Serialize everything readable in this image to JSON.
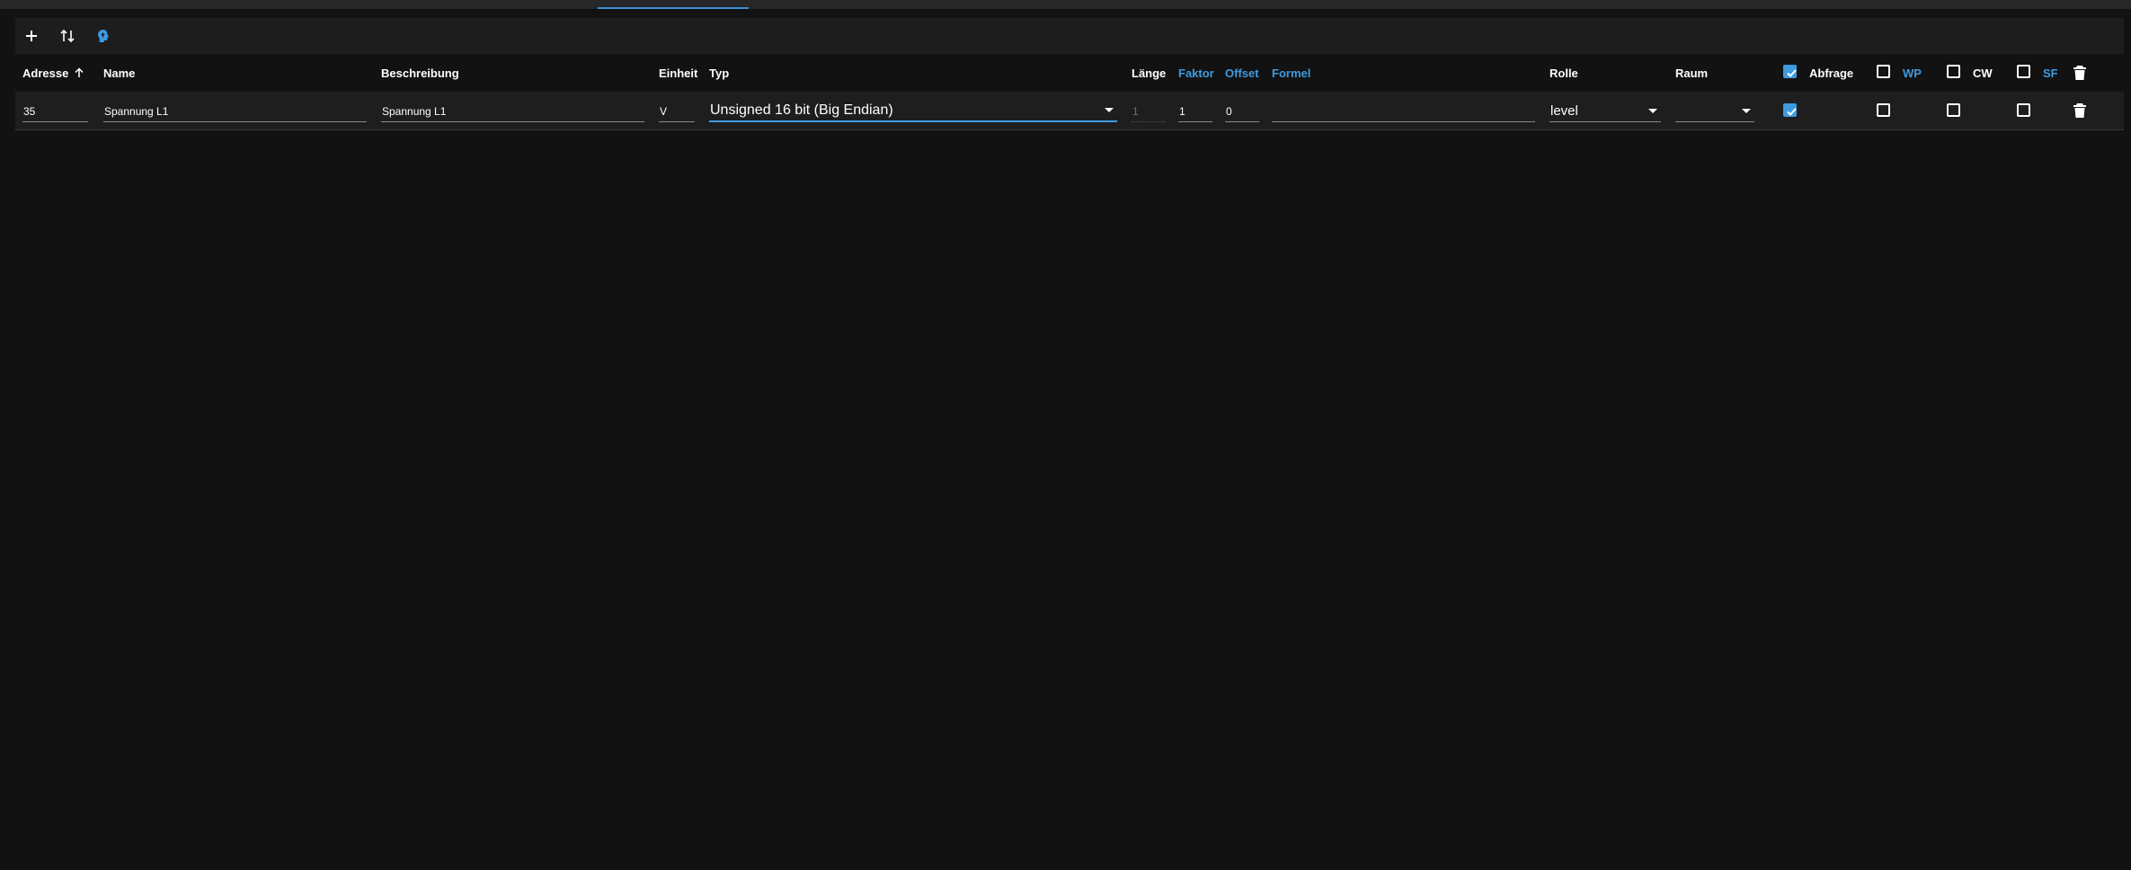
{
  "toolbar": {
    "add_icon": "plus-icon",
    "sort_icon": "sort-arrows-icon",
    "import_icon": "brain-icon"
  },
  "table": {
    "headers": {
      "adresse": "Adresse",
      "name": "Name",
      "beschreibung": "Beschreibung",
      "einheit": "Einheit",
      "typ": "Typ",
      "laenge": "Länge",
      "faktor": "Faktor",
      "offset": "Offset",
      "formel": "Formel",
      "rolle": "Rolle",
      "raum": "Raum",
      "abfrage": "Abfrage",
      "wp": "WP",
      "cw": "CW",
      "sf": "SF"
    },
    "row": {
      "adresse": "35",
      "name": "Spannung L1",
      "beschreibung": "Spannung L1",
      "einheit": "V",
      "typ": "Unsigned 16 bit (Big Endian)",
      "laenge": "1",
      "faktor": "1",
      "offset": "0",
      "formel": "",
      "rolle": "level",
      "raum": "",
      "abfrage_checked": true,
      "wp_checked": false,
      "cw_checked": false,
      "sf_checked": false
    }
  },
  "colors": {
    "background": "#121212",
    "accent": "#3f9be0",
    "row_background": "#1e1e1e"
  }
}
